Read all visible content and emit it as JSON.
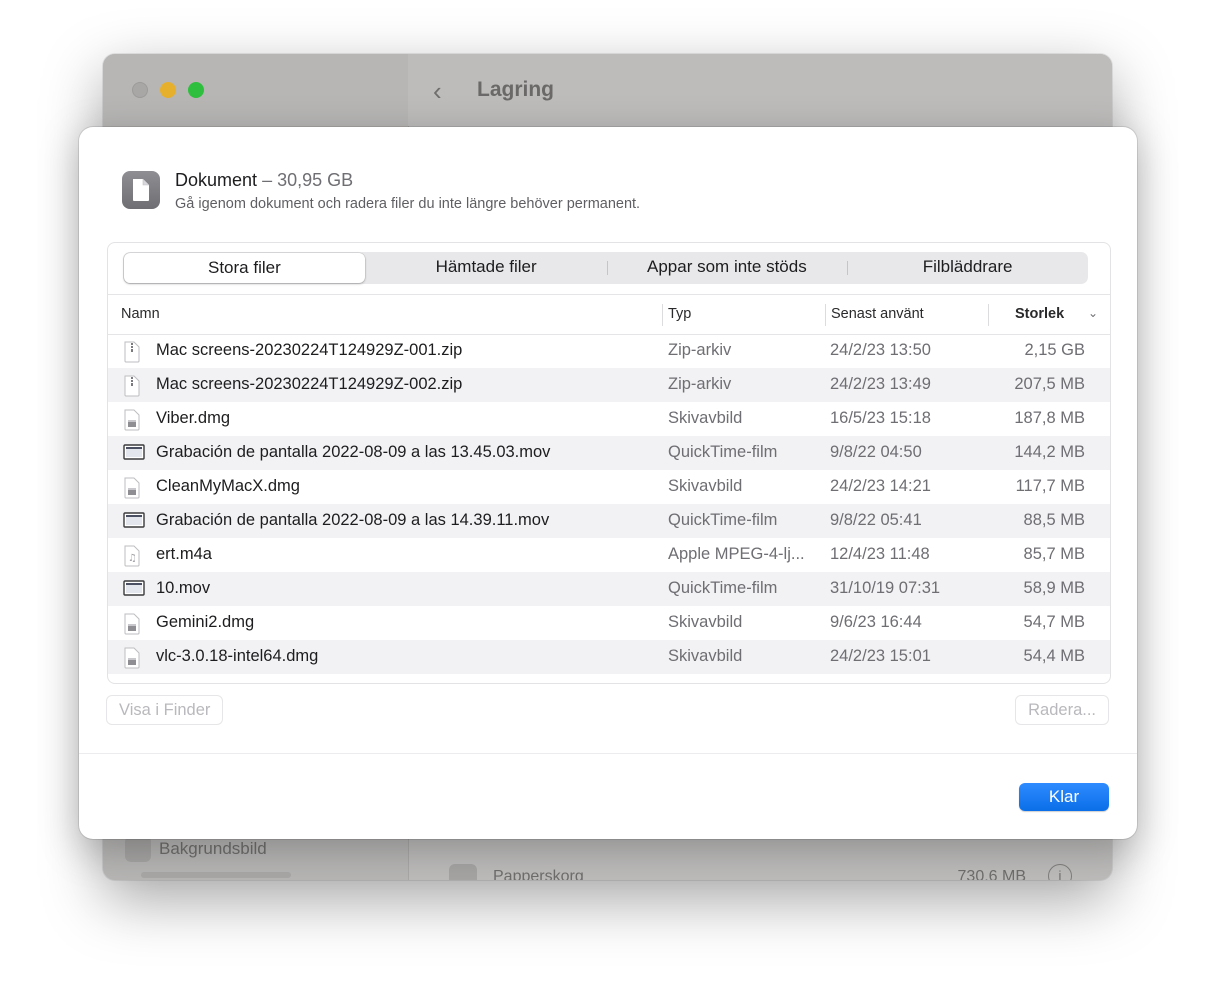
{
  "window": {
    "title": "Lagring",
    "sidebar_item": "Bakgrundsbild",
    "bg_row": {
      "label": "Papperskorg",
      "value": "730,6 MB"
    }
  },
  "sheet": {
    "title": "Dokument",
    "size": "– 30,95 GB",
    "subtitle": "Gå igenom dokument och radera filer du inte längre behöver permanent.",
    "tabs": [
      "Stora filer",
      "Hämtade filer",
      "Appar som inte stöds",
      "Filbläddrare"
    ],
    "columns": {
      "name": "Namn",
      "type": "Typ",
      "last_used": "Senast använt",
      "size": "Storlek"
    },
    "rows": [
      {
        "name": "Mac screens-20230224T124929Z-001.zip",
        "type": "Zip-arkiv",
        "date": "24/2/23 13:50",
        "size": "2,15 GB",
        "icon": "zip-icon"
      },
      {
        "name": "Mac screens-20230224T124929Z-002.zip",
        "type": "Zip-arkiv",
        "date": "24/2/23 13:49",
        "size": "207,5 MB",
        "icon": "zip-icon"
      },
      {
        "name": "Viber.dmg",
        "type": "Skivavbild",
        "date": "16/5/23 15:18",
        "size": "187,8 MB",
        "icon": "dmg-icon"
      },
      {
        "name": "Grabación de pantalla 2022-08-09 a las 13.45.03.mov",
        "type": "QuickTime-film",
        "date": "9/8/22 04:50",
        "size": "144,2 MB",
        "icon": "movie-icon"
      },
      {
        "name": "CleanMyMacX.dmg",
        "type": "Skivavbild",
        "date": "24/2/23 14:21",
        "size": "117,7 MB",
        "icon": "dmg-icon"
      },
      {
        "name": "Grabación de pantalla 2022-08-09 a las 14.39.11.mov",
        "type": "QuickTime-film",
        "date": "9/8/22 05:41",
        "size": "88,5 MB",
        "icon": "movie-icon"
      },
      {
        "name": "ert.m4a",
        "type": "Apple MPEG-4-lj...",
        "date": "12/4/23 11:48",
        "size": "85,7 MB",
        "icon": "audio-icon"
      },
      {
        "name": "10.mov",
        "type": "QuickTime-film",
        "date": "31/10/19 07:31",
        "size": "58,9 MB",
        "icon": "movie-icon"
      },
      {
        "name": "Gemini2.dmg",
        "type": "Skivavbild",
        "date": "9/6/23 16:44",
        "size": "54,7 MB",
        "icon": "dmg-icon"
      },
      {
        "name": "vlc-3.0.18-intel64.dmg",
        "type": "Skivavbild",
        "date": "24/2/23 15:01",
        "size": "54,4 MB",
        "icon": "dmg-icon"
      }
    ],
    "buttons": {
      "show_in_finder": "Visa i Finder",
      "delete": "Radera...",
      "done": "Klar"
    }
  },
  "colors": {
    "accent": "#0a6fe8"
  }
}
